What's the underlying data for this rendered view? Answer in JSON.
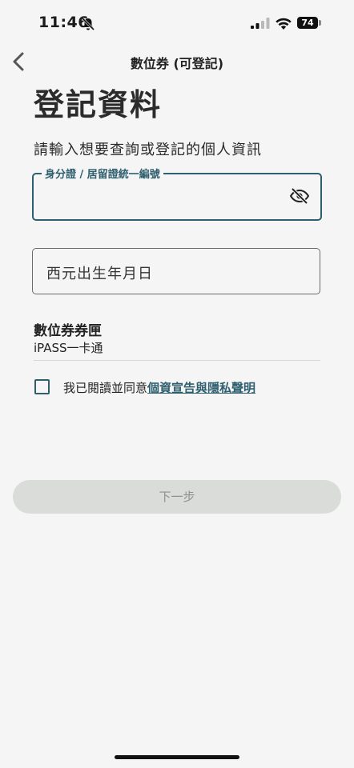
{
  "status_bar": {
    "time": "11:46",
    "battery_level": "74",
    "icons": [
      "bell-off-icon",
      "signal-icon",
      "wifi-icon",
      "battery-icon"
    ]
  },
  "nav": {
    "back_icon": "chevron-left-icon",
    "title": "數位券 (可登記)"
  },
  "page": {
    "title": "登記資料",
    "subtitle": "請輸入想要查詢或登記的個人資訊"
  },
  "form": {
    "id_field": {
      "label": "身分證 / 居留證統一編號",
      "value": "",
      "toggle_icon": "eye-off-icon"
    },
    "birth_field": {
      "placeholder": "西元出生年月日",
      "value": ""
    },
    "wallet": {
      "label": "數位券券匣",
      "value": "iPASS一卡通"
    },
    "agreement": {
      "checked": false,
      "text": "我已閱讀並同意",
      "link_text": "個資宣告與隱私聲明"
    },
    "next_button": "下一步"
  },
  "colors": {
    "background": "#f4f5f4",
    "accent": "#2f5f6e",
    "button_disabled": "#dadcda",
    "button_text_disabled": "#8e9090"
  }
}
